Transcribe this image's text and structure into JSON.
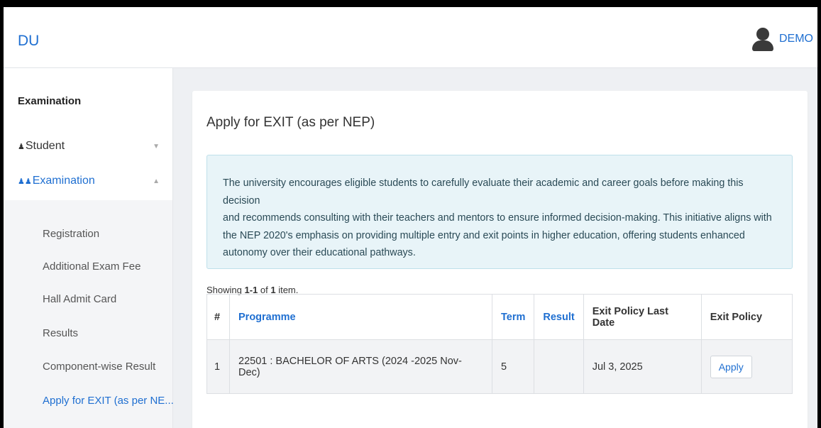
{
  "header": {
    "brand": "DU",
    "user_name": "DEMO"
  },
  "sidebar": {
    "heading": "Examination",
    "groups": [
      {
        "label": "Student",
        "icon": "user-icon",
        "caret": "▼",
        "expanded": false
      },
      {
        "label": "Examination",
        "icon": "users-icon",
        "caret": "▲",
        "expanded": true
      }
    ],
    "items": [
      {
        "label": "Registration",
        "active": false
      },
      {
        "label": "Additional Exam Fee",
        "active": false
      },
      {
        "label": "Hall Admit Card",
        "active": false
      },
      {
        "label": "Results",
        "active": false
      },
      {
        "label": "Component-wise Result",
        "active": false
      },
      {
        "label": "Apply for EXIT (as per NE...",
        "active": true
      }
    ]
  },
  "main": {
    "title": "Apply for EXIT (as per NEP)",
    "info_lines": [
      "The university encourages eligible students to carefully evaluate their academic and career goals before making this decision",
      "and recommends consulting with their teachers and mentors to ensure informed decision-making. This initiative aligns with",
      "the NEP 2020's emphasis on providing multiple entry and exit points in higher education, offering students enhanced",
      "autonomy over their educational pathways."
    ],
    "summary": {
      "prefix": "Showing ",
      "range": "1-1",
      "middle": " of ",
      "total": "1",
      "suffix": " item."
    },
    "table": {
      "headers": [
        "#",
        "Programme",
        "Term",
        "Result",
        "Exit Policy Last Date",
        "Exit Policy"
      ],
      "rows": [
        {
          "num": "1",
          "programme": "22501 : BACHELOR OF ARTS (2024 -2025 Nov-Dec)",
          "term": "5",
          "result": "",
          "last_date": "Jul 3, 2025",
          "action": "Apply"
        }
      ]
    }
  },
  "colors": {
    "accent": "#1f6fd1",
    "info_bg": "#e8f4f8",
    "page_bg": "#eef0f3"
  }
}
